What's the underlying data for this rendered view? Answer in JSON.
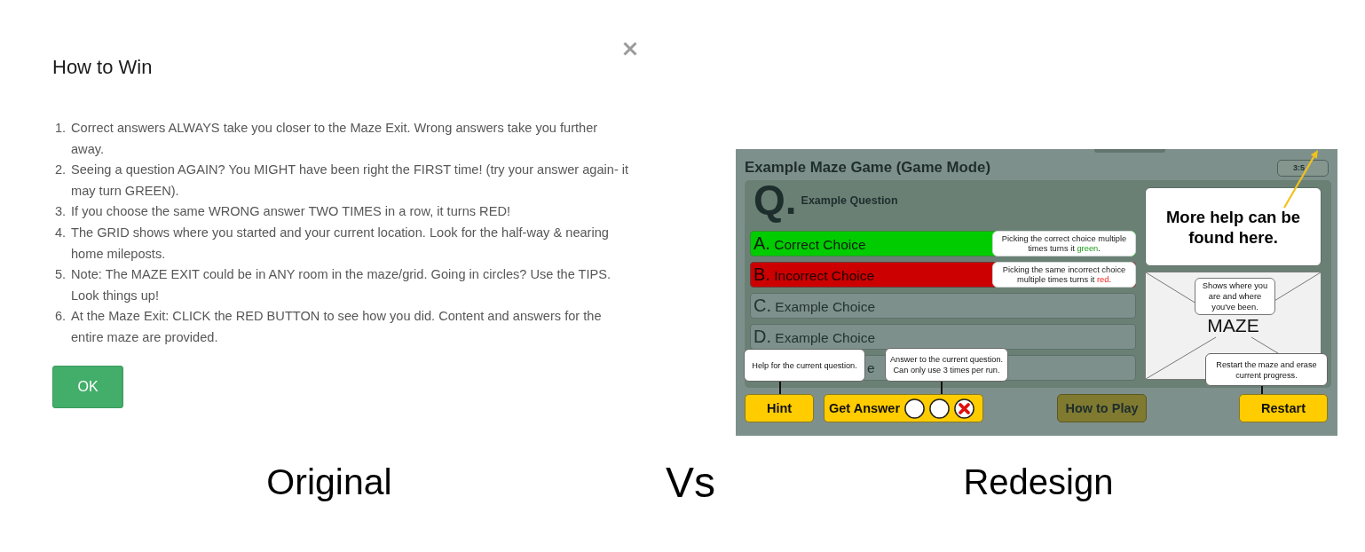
{
  "original": {
    "dialog": {
      "title": "How to Win",
      "instructions": [
        {
          "number": "1.",
          "text": "Correct answers ALWAYS take you closer to the Maze Exit. Wrong answers take you further away."
        },
        {
          "number": "2.",
          "text": "Seeing a question AGAIN? You MIGHT have been right the FIRST time! (try your answer again- it may turn GREEN)."
        },
        {
          "number": "3.",
          "text": "If you choose the same WRONG answer TWO TIMES in a row, it turns RED!"
        },
        {
          "number": "4.",
          "text": "The GRID shows where you started and your current location. Look for the half-way & nearing home mileposts."
        },
        {
          "number": "5.",
          "text": "Note: The MAZE EXIT could be in ANY room in the maze/grid. Going in circles? Use the TIPS. Look things up!"
        },
        {
          "number": "6.",
          "text": "At the Maze Exit: CLICK the RED BUTTON to see how you did. Content and answers for the entire maze are provided."
        }
      ],
      "ok_button": "OK"
    }
  },
  "redesign": {
    "game": {
      "title": "Example Maze Game (Game Mode)",
      "timer": "3:5",
      "question": {
        "mark": "Q.",
        "text": "Example Question"
      },
      "choices": [
        {
          "letter": "A.",
          "text": "Correct Choice",
          "kind": "correct",
          "note": {
            "before": "Picking the correct choice multiple times turns it ",
            "highlight": "green",
            "after": "."
          }
        },
        {
          "letter": "B.",
          "text": "Incorrect Choice",
          "kind": "incorrect",
          "note": {
            "before": "Picking the same incorrect choice multiple times turns it ",
            "highlight": "red",
            "after": "."
          }
        },
        {
          "letter": "C.",
          "text": "Example Choice",
          "kind": "plain"
        },
        {
          "letter": "D.",
          "text": "Example Choice",
          "kind": "plain"
        },
        {
          "text": "e",
          "kind": "plain"
        }
      ],
      "help_panel": "More help can be found here.",
      "maze": {
        "label": "MAZE",
        "note": "Shows where you are and where you've been."
      },
      "buttons": [
        {
          "kind": "hint",
          "label": "Hint",
          "note": "Help for the current question."
        },
        {
          "kind": "answer",
          "label": "Get Answer",
          "note": "Answer to the current question. Can only use 3 times per run.",
          "uses": [
            {
              "used": false
            },
            {
              "used": false
            },
            {
              "used": true
            }
          ]
        },
        {
          "kind": "how_to_play",
          "label": "How to Play"
        },
        {
          "kind": "restart",
          "label": "Restart",
          "note": "Restart the maze and erase current progress."
        }
      ]
    }
  },
  "captions": {
    "left": "Original",
    "middle": "Vs",
    "right": "Redesign"
  }
}
